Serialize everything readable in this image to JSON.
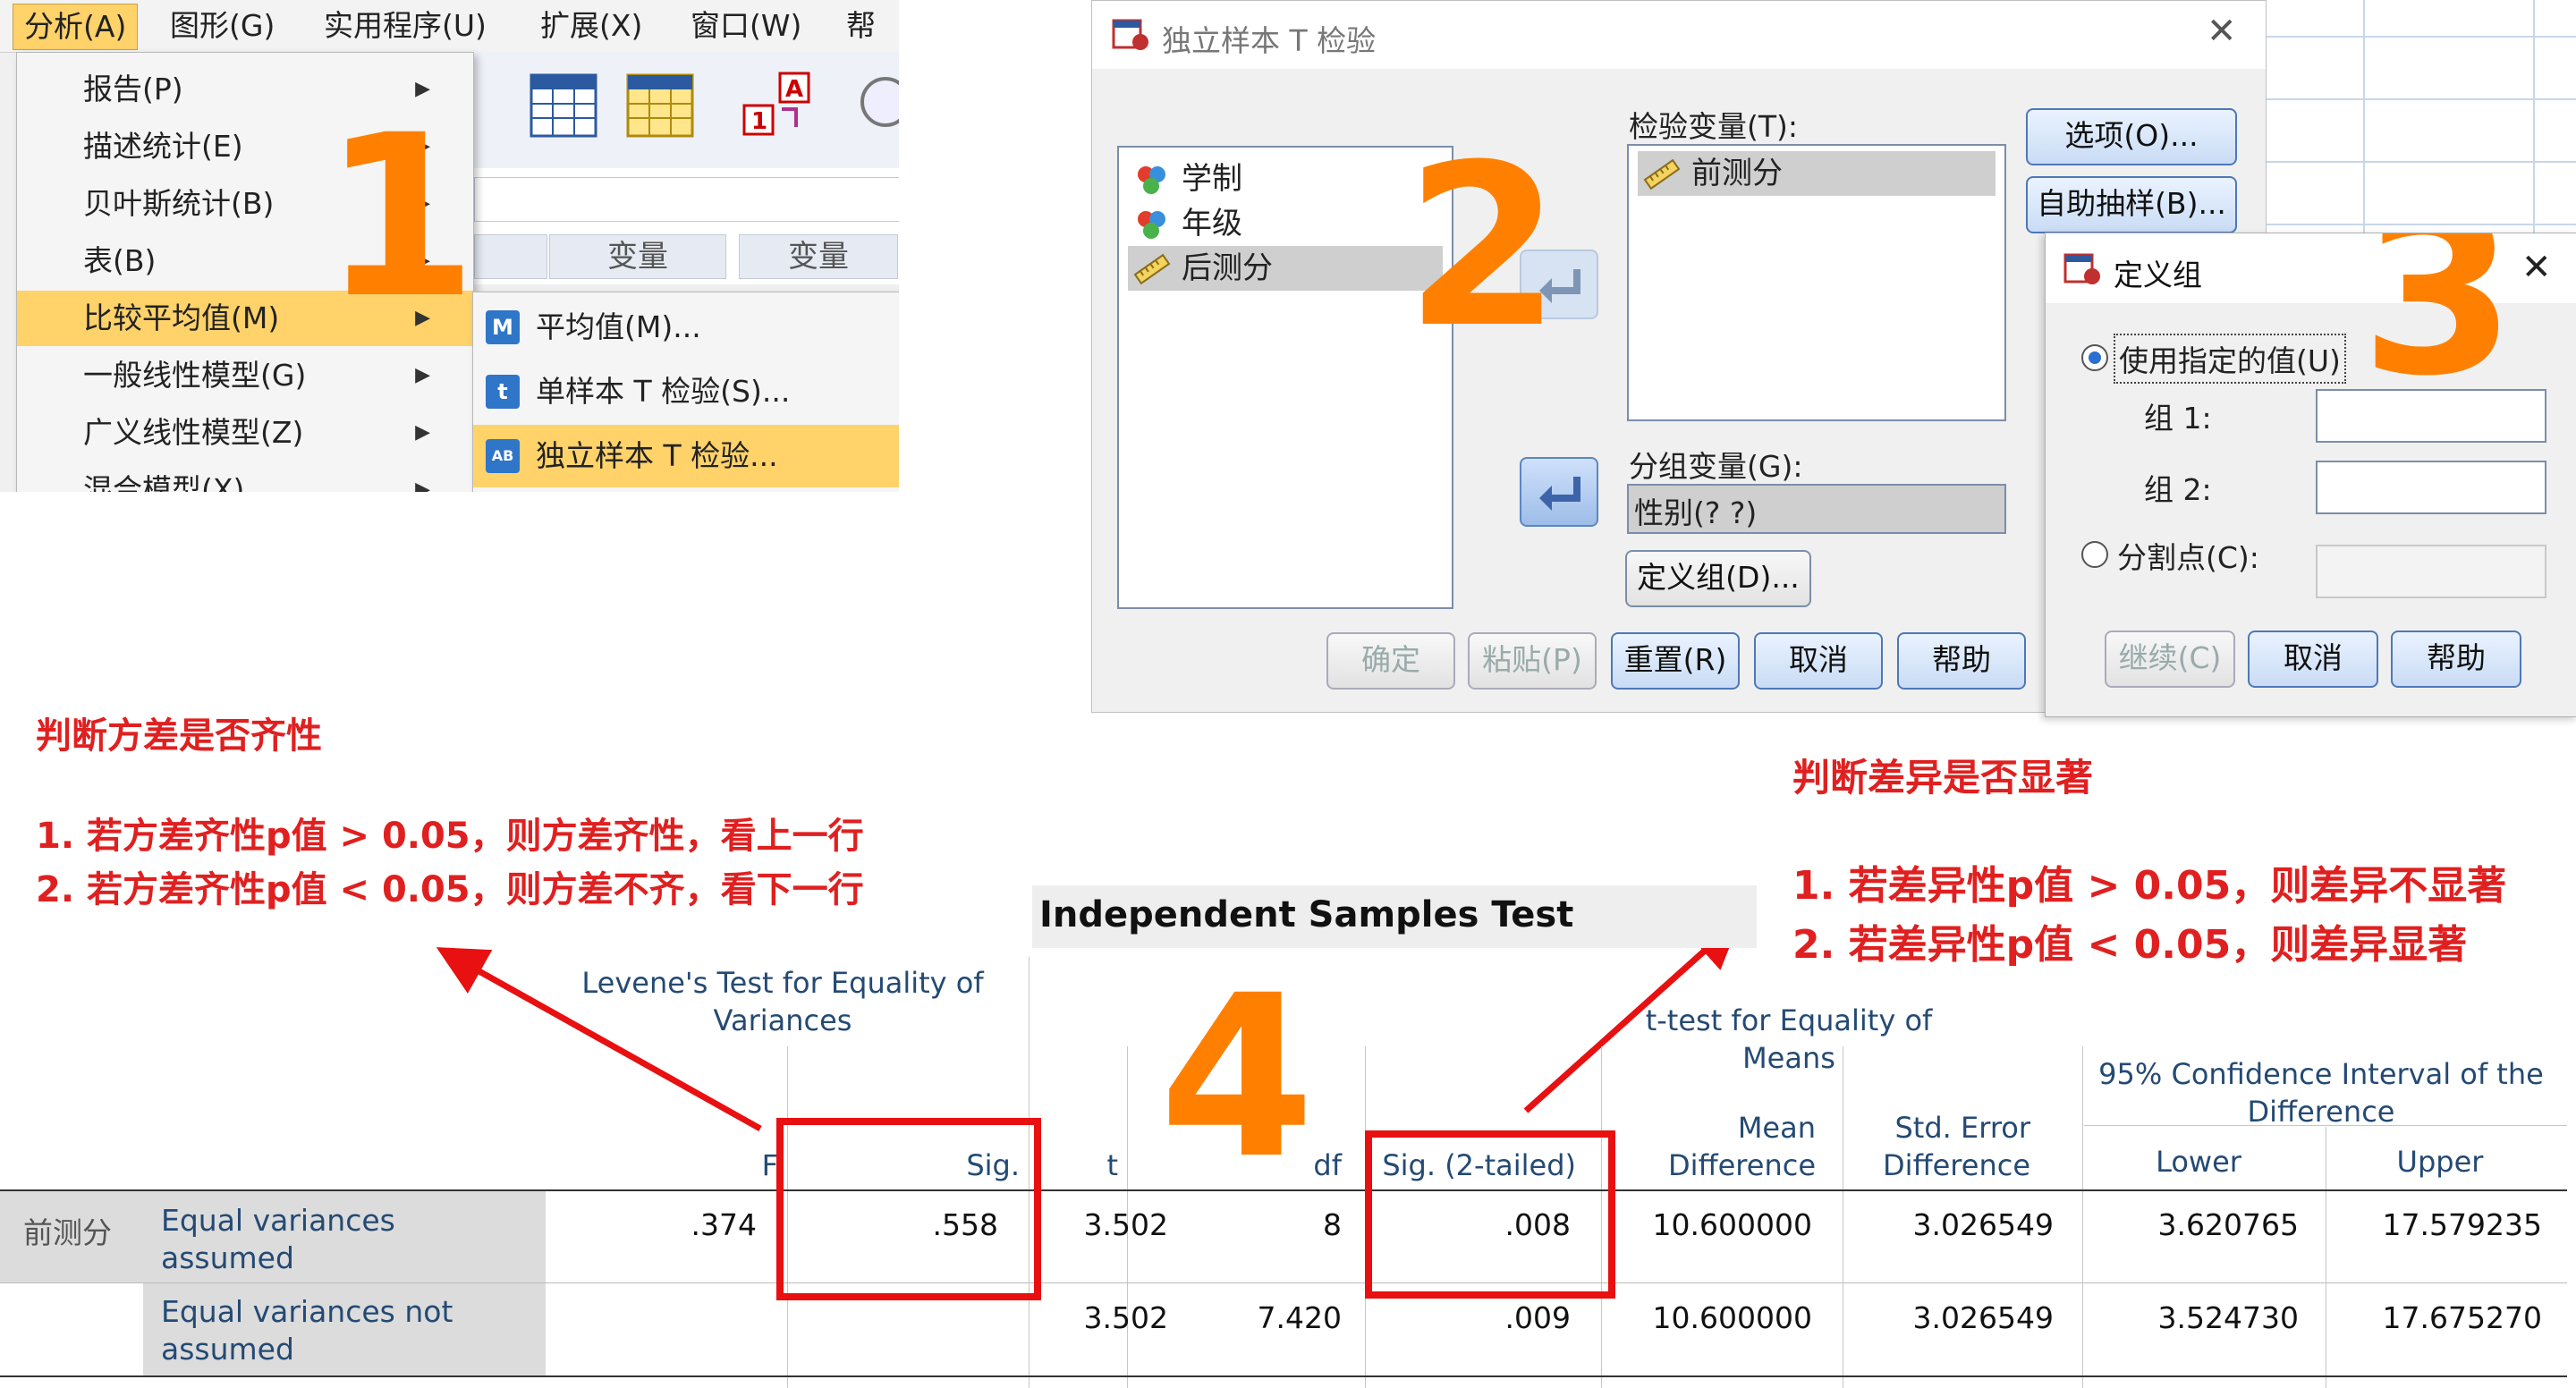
{
  "menu_panel": {
    "menubar": [
      "分析(A)",
      "图形(G)",
      "实用程序(U)",
      "扩展(X)",
      "窗口(W)",
      "帮助"
    ],
    "analyze_items": [
      "报告(P)",
      "描述统计(E)",
      "贝叶斯统计(B)",
      "表(B)",
      "比较平均值(M)",
      "一般线性模型(G)",
      "广义线性模型(Z)",
      "混合模型(X)"
    ],
    "var_columns": [
      "变量",
      "变量"
    ],
    "compare_submenu": [
      {
        "icon": "M",
        "label": "平均值(M)..."
      },
      {
        "icon": "t",
        "label": "单样本 T 检验(S)..."
      },
      {
        "icon": "AB",
        "label": "独立样本 T 检验..."
      }
    ],
    "step": "1"
  },
  "ttest_dialog": {
    "title": "独立样本 T 检验",
    "source_vars": [
      "学制",
      "年级",
      "后测分"
    ],
    "test_var_label": "检验变量(T):",
    "test_vars": [
      "前测分"
    ],
    "group_var_label": "分组变量(G):",
    "group_var_value": "性别(? ?)",
    "buttons_right": [
      "选项(O)...",
      "自助抽样(B)..."
    ],
    "define_groups_button": "定义组(D)...",
    "bottom_buttons": [
      "确定",
      "粘贴(P)",
      "重置(R)",
      "取消",
      "帮助"
    ],
    "step": "2"
  },
  "define_groups_dialog": {
    "title": "定义组",
    "radio_specified": "使用指定的值(U)",
    "group1_label": "组 1:",
    "group2_label": "组 2:",
    "radio_cutpoint": "分割点(C):",
    "buttons": [
      "继续(C)",
      "取消",
      "帮助"
    ],
    "step": "3"
  },
  "annotations": {
    "left_title": "判断方差是否齐性",
    "left_rule1": "1. 若方差齐性p值 > 0.05，则方差齐性，看上一行",
    "left_rule2": "2. 若方差齐性p值 < 0.05，则方差不齐，看下一行",
    "right_title": "判断差异是否显著",
    "right_rule1": "1. 若差异性p值 > 0.05，则差异不显著",
    "right_rule2": "2. 若差异性p值 < 0.05，则差异显著",
    "step4": "4"
  },
  "output_table": {
    "title": "Independent Samples Test",
    "group_header_levene": "Levene's Test for Equality of Variances",
    "group_header_ttest": "t-test for Equality of Means",
    "group_header_ci": "95% Confidence Interval of the Difference",
    "columns": [
      "F",
      "Sig.",
      "t",
      "df",
      "Sig. (2-tailed)",
      "Mean Difference",
      "Std. Error Difference",
      "Lower",
      "Upper"
    ],
    "variable": "前测分",
    "rows": [
      {
        "label": "Equal variances assumed",
        "F": ".374",
        "Sig": ".558",
        "t": "3.502",
        "df": "8",
        "sig2": ".008",
        "mean_diff": "10.600000",
        "se_diff": "3.026549",
        "lower": "3.620765",
        "upper": "17.579235"
      },
      {
        "label": "Equal variances not assumed",
        "F": "",
        "Sig": "",
        "t": "3.502",
        "df": "7.420",
        "sig2": ".009",
        "mean_diff": "10.600000",
        "se_diff": "3.026549",
        "lower": "3.524730",
        "upper": "17.675270"
      }
    ]
  },
  "colors": {
    "accent_orange": "#ff8000",
    "annotation_red": "#e02020",
    "menu_highlight": "#ffd26a"
  }
}
